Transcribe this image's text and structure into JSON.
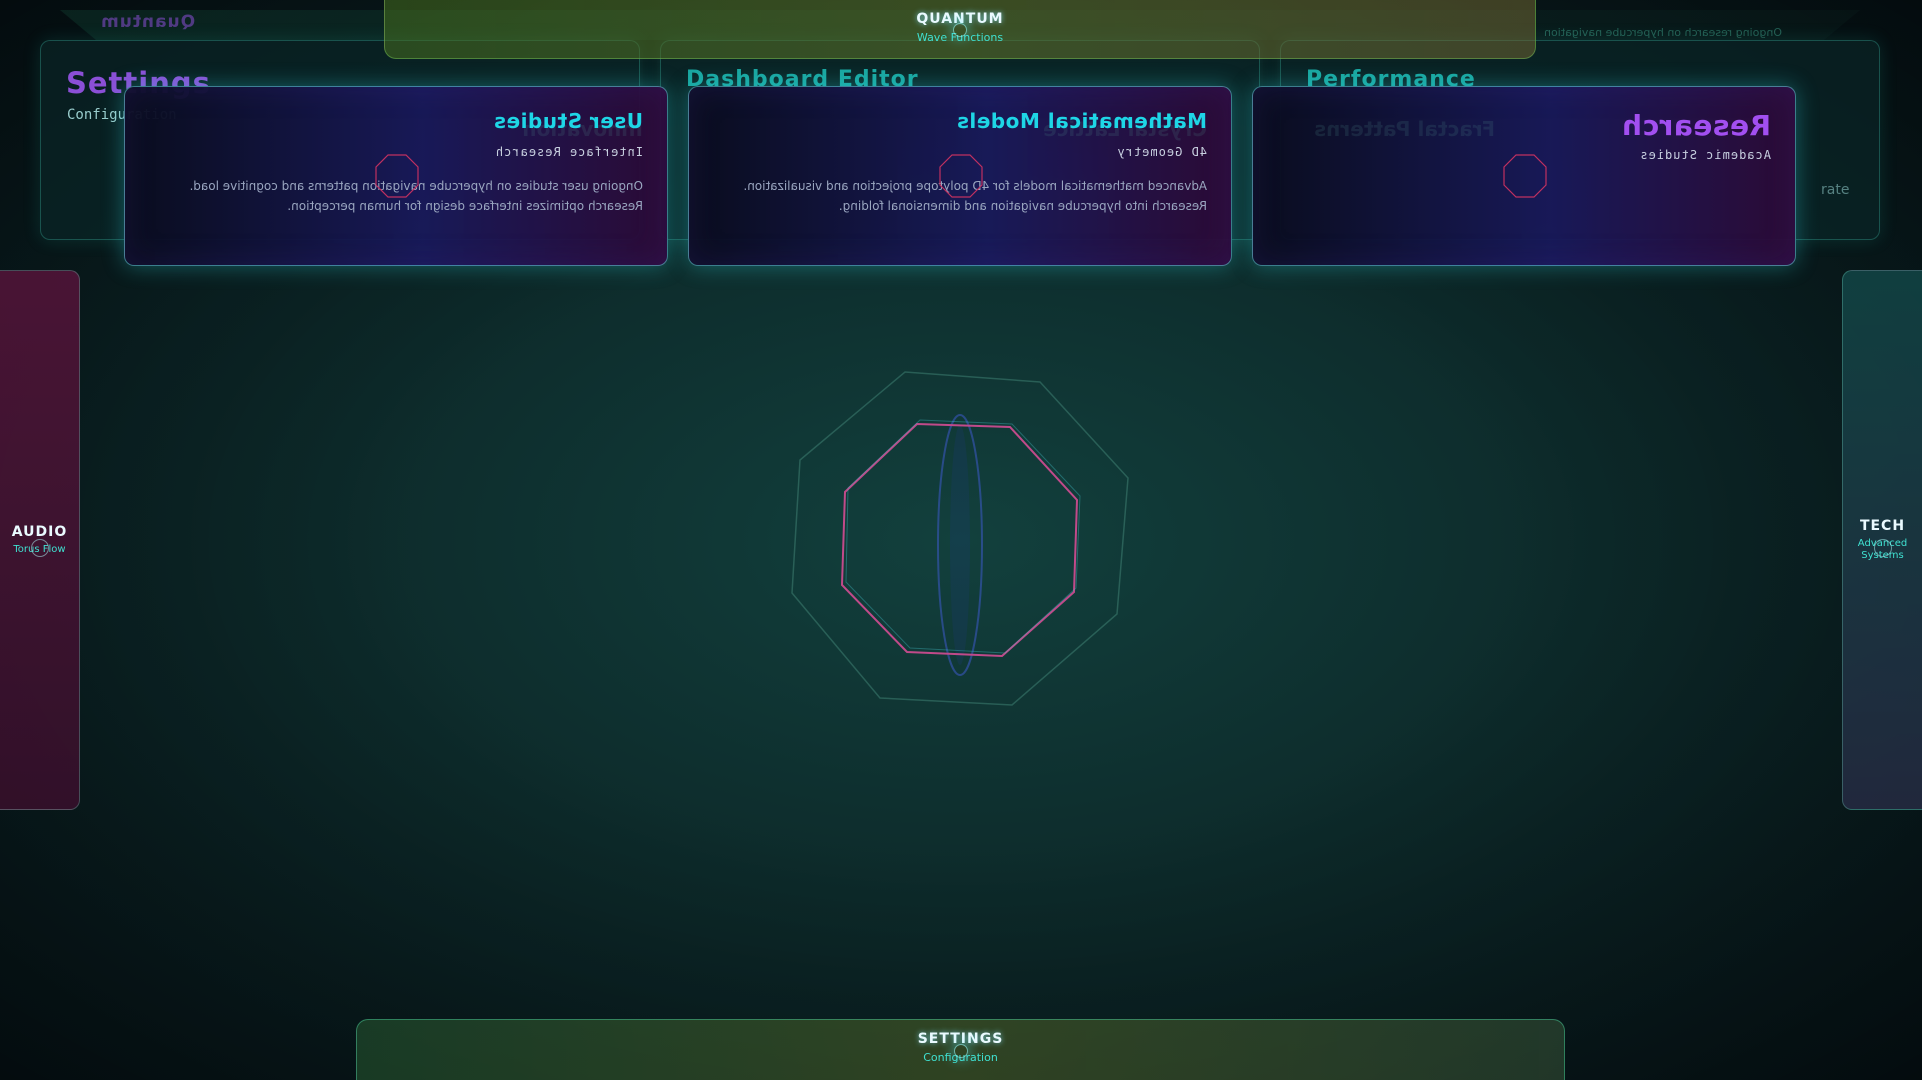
{
  "background": {
    "logo": "Quantum",
    "strip_text": "Ongoing research on hypercube navigation",
    "panels": [
      {
        "title": "Settings",
        "subtitle": "Configuration",
        "color": "#8b4fd6"
      },
      {
        "title": "Dashboard Editor",
        "subtitle": "",
        "color": "#1aa6a0"
      },
      {
        "title": "Performance",
        "subtitle": "",
        "color": "#1aa6a0"
      }
    ],
    "side_word": "rate"
  },
  "top_nav": {
    "label": "QUANTUM",
    "sub": "Wave Functions"
  },
  "bottom_nav": {
    "label": "SETTINGS",
    "sub": "Configuration"
  },
  "left_nav": {
    "label": "AUDIO",
    "sub": "Torus Flow"
  },
  "right_nav": {
    "label": "TECH",
    "sub": "Advanced Systems"
  },
  "cards": [
    {
      "title": "User Studies",
      "category": "Interface Research",
      "description": "Ongoing user studies on hypercube navigation patterns and cognitive load. Research optimizes interface design for human perception.",
      "ghost": "Innovation",
      "title_color": "#1ed6e6"
    },
    {
      "title": "Mathematical Models",
      "category": "4D Geometry",
      "description": "Advanced mathematical models for 4D polytope projection and visualization. Research into hypercube navigation and dimensional folding.",
      "ghost": "Crystal Lattice",
      "title_color": "#1ed6e6"
    },
    {
      "title": "Research",
      "category": "Academic Studies",
      "description": "",
      "ghost": "Fractal Patterns",
      "title_color": "#a24ff0"
    }
  ],
  "colors": {
    "accent_cyan": "#1ed6e6",
    "accent_purple": "#a24ff0",
    "accent_pink": "#d0408a"
  }
}
